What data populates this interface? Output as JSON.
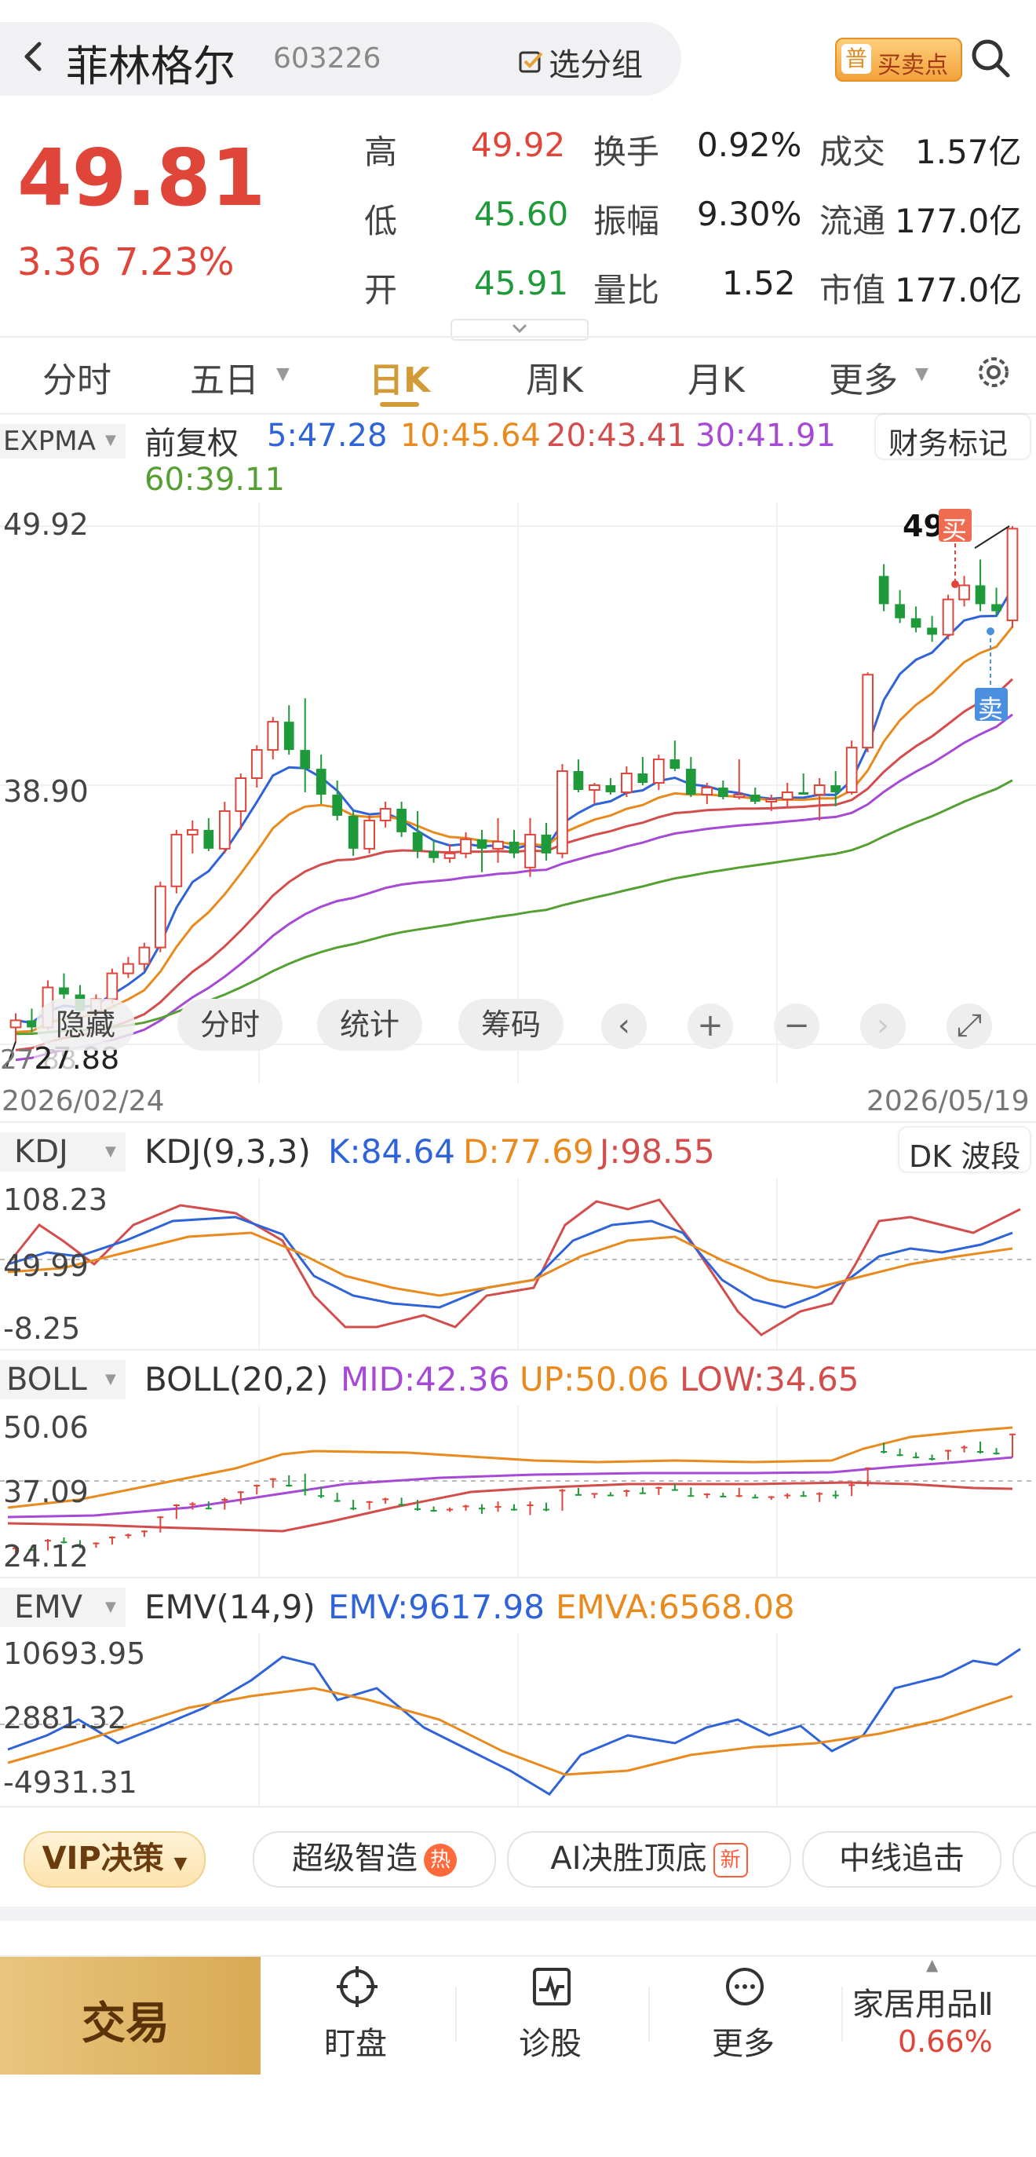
{
  "header": {
    "back_icon": "chevron-left-icon",
    "stock_name": "菲林格尔",
    "stock_code": "603226",
    "group_button": "选分组",
    "buy_sell_badge": "买卖点",
    "search_icon": "search-icon"
  },
  "quote": {
    "price": "49.81",
    "change": "3.36",
    "change_pct": "7.23%",
    "rows": [
      {
        "l1": "高",
        "v1": "49.92",
        "l2": "换手",
        "v2": "0.92%",
        "l3": "成交",
        "v3": "1.57亿"
      },
      {
        "l1": "低",
        "v1": "45.60",
        "l2": "振幅",
        "v2": "9.30%",
        "l3": "流通",
        "v3": "177.0亿"
      },
      {
        "l1": "开",
        "v1": "45.91",
        "l2": "量比",
        "v2": "1.52",
        "l3": "市值",
        "v3": "177.0亿"
      }
    ]
  },
  "period_tabs": [
    "分时",
    "五日",
    "日K",
    "周K",
    "月K",
    "更多"
  ],
  "main_chart": {
    "indicator": "EXPMA",
    "adjust": "前复权",
    "ma": [
      {
        "label": "5:47.28",
        "color": "#2f63d8"
      },
      {
        "label": "10:45.64",
        "color": "#e88a1d"
      },
      {
        "label": "20:43.41",
        "color": "#d44d4d"
      },
      {
        "label": "30:41.91",
        "color": "#a64ad6"
      },
      {
        "label": "60:39.11",
        "color": "#56a033"
      }
    ],
    "finance_btn": "财务标记",
    "y_high": "49.92",
    "y_mid": "38.90",
    "low_label": "27.88",
    "low_label_left": "27.88",
    "high_marker": "49",
    "buy_marker": "买",
    "sell_marker": "卖",
    "date_start": "2026/02/24",
    "date_end": "2026/05/19"
  },
  "toolbar": {
    "hide": "隐藏",
    "intraday": "分时",
    "stats": "统计",
    "chips": "筹码"
  },
  "kdj": {
    "name": "KDJ",
    "params": "KDJ(9,3,3)",
    "k": "K:84.64",
    "d": "D:77.69",
    "j": "J:98.55",
    "btn": "DK 波段",
    "y_top": "108.23",
    "y_mid": "49.99",
    "y_bot": "-8.25"
  },
  "boll": {
    "name": "BOLL",
    "params": "BOLL(20,2)",
    "mid": "MID:42.36",
    "up": "UP:50.06",
    "low": "LOW:34.65",
    "y_top": "50.06",
    "y_mid": "37.09",
    "y_bot": "24.12"
  },
  "emv": {
    "name": "EMV",
    "params": "EMV(14,9)",
    "emv": "EMV:9617.98",
    "emva": "EMVA:6568.08",
    "y_top": "10693.95",
    "y_mid": "2881.32",
    "y_bot": "-4931.31"
  },
  "strategies": {
    "vip": "VIP决策",
    "items": [
      "超级智造",
      "AI决胜顶底",
      "中线追击"
    ],
    "hot": "热",
    "new": "新"
  },
  "bottom_nav": {
    "trade": "交易",
    "items": [
      "盯盘",
      "诊股",
      "更多"
    ],
    "sector_name": "家居用品Ⅱ",
    "sector_change": "0.66%"
  },
  "chart_data": {
    "type": "candlestick",
    "title": "",
    "ylim": [
      27.88,
      49.92
    ],
    "candles": [
      [
        28.6,
        29.2,
        28.0,
        28.9
      ],
      [
        28.9,
        29.4,
        28.4,
        28.6
      ],
      [
        28.6,
        30.6,
        28.5,
        30.3
      ],
      [
        30.3,
        30.9,
        29.8,
        30.0
      ],
      [
        30.0,
        30.4,
        28.9,
        29.3
      ],
      [
        29.3,
        30.0,
        29.0,
        29.8
      ],
      [
        29.8,
        31.1,
        29.6,
        30.9
      ],
      [
        30.9,
        31.6,
        30.7,
        31.3
      ],
      [
        31.3,
        32.2,
        31.0,
        32.0
      ],
      [
        32.0,
        34.8,
        31.8,
        34.6
      ],
      [
        34.6,
        37.0,
        34.3,
        36.8
      ],
      [
        36.8,
        37.4,
        36.0,
        37.0
      ],
      [
        37.0,
        37.5,
        36.1,
        36.2
      ],
      [
        36.2,
        38.2,
        36.0,
        37.8
      ],
      [
        37.8,
        39.4,
        37.0,
        39.2
      ],
      [
        39.2,
        40.6,
        38.8,
        40.4
      ],
      [
        40.4,
        41.8,
        40.0,
        41.6
      ],
      [
        41.6,
        42.3,
        40.2,
        40.4
      ],
      [
        40.4,
        42.6,
        38.6,
        39.6
      ],
      [
        39.6,
        40.2,
        38.1,
        38.5
      ],
      [
        38.5,
        39.1,
        37.4,
        37.6
      ],
      [
        37.6,
        37.8,
        35.9,
        36.2
      ],
      [
        36.2,
        37.6,
        36.0,
        37.4
      ],
      [
        37.4,
        38.2,
        37.1,
        37.9
      ],
      [
        37.9,
        38.2,
        36.7,
        36.9
      ],
      [
        36.9,
        37.8,
        35.8,
        36.1
      ],
      [
        36.1,
        36.6,
        35.6,
        35.8
      ],
      [
        35.8,
        36.4,
        35.6,
        36.0
      ],
      [
        36.0,
        36.9,
        35.8,
        36.6
      ],
      [
        36.6,
        37.0,
        35.2,
        36.2
      ],
      [
        36.2,
        37.5,
        35.6,
        36.5
      ],
      [
        36.5,
        37.0,
        35.8,
        36.0
      ],
      [
        35.4,
        37.5,
        35.0,
        36.8
      ],
      [
        36.8,
        37.3,
        35.7,
        36.0
      ],
      [
        36.0,
        39.8,
        35.8,
        39.5
      ],
      [
        39.5,
        40.0,
        38.6,
        38.7
      ],
      [
        38.7,
        39.0,
        38.1,
        38.9
      ],
      [
        38.9,
        39.2,
        38.5,
        38.6
      ],
      [
        38.6,
        39.7,
        38.4,
        39.4
      ],
      [
        39.4,
        40.1,
        38.9,
        39.0
      ],
      [
        39.0,
        40.2,
        38.7,
        40.0
      ],
      [
        40.0,
        40.8,
        39.5,
        39.6
      ],
      [
        39.6,
        40.1,
        38.4,
        38.5
      ],
      [
        38.5,
        39.0,
        38.1,
        38.8
      ],
      [
        38.8,
        39.1,
        38.3,
        38.4
      ],
      [
        38.4,
        40.0,
        38.3,
        38.5
      ],
      [
        38.5,
        38.8,
        38.1,
        38.2
      ],
      [
        38.2,
        38.5,
        37.8,
        38.3
      ],
      [
        38.3,
        39.0,
        38.0,
        38.6
      ],
      [
        38.6,
        39.4,
        38.5,
        38.5
      ],
      [
        38.5,
        39.2,
        37.4,
        38.9
      ],
      [
        38.9,
        39.5,
        38.0,
        38.6
      ],
      [
        38.6,
        40.8,
        38.5,
        40.5
      ],
      [
        40.5,
        43.7,
        40.3,
        43.6
      ],
      [
        47.8,
        48.3,
        46.3,
        46.6
      ],
      [
        46.6,
        47.2,
        45.8,
        46.0
      ],
      [
        46.0,
        46.5,
        45.4,
        45.6
      ],
      [
        45.6,
        46.1,
        45.0,
        45.3
      ],
      [
        45.3,
        47.0,
        45.1,
        46.8
      ],
      [
        46.8,
        47.8,
        46.5,
        47.4
      ],
      [
        47.4,
        48.5,
        46.3,
        46.6
      ],
      [
        46.6,
        47.3,
        46.1,
        46.3
      ],
      [
        45.91,
        49.92,
        45.6,
        49.81
      ]
    ],
    "series": [
      {
        "name": "5",
        "last": 47.28
      },
      {
        "name": "10",
        "last": 45.64
      },
      {
        "name": "20",
        "last": 43.41
      },
      {
        "name": "30",
        "last": 41.91
      },
      {
        "name": "60",
        "last": 39.11
      }
    ]
  },
  "colors": {
    "up": "#e0453a",
    "down": "#1e9a3a",
    "accent": "#e9b04b"
  }
}
